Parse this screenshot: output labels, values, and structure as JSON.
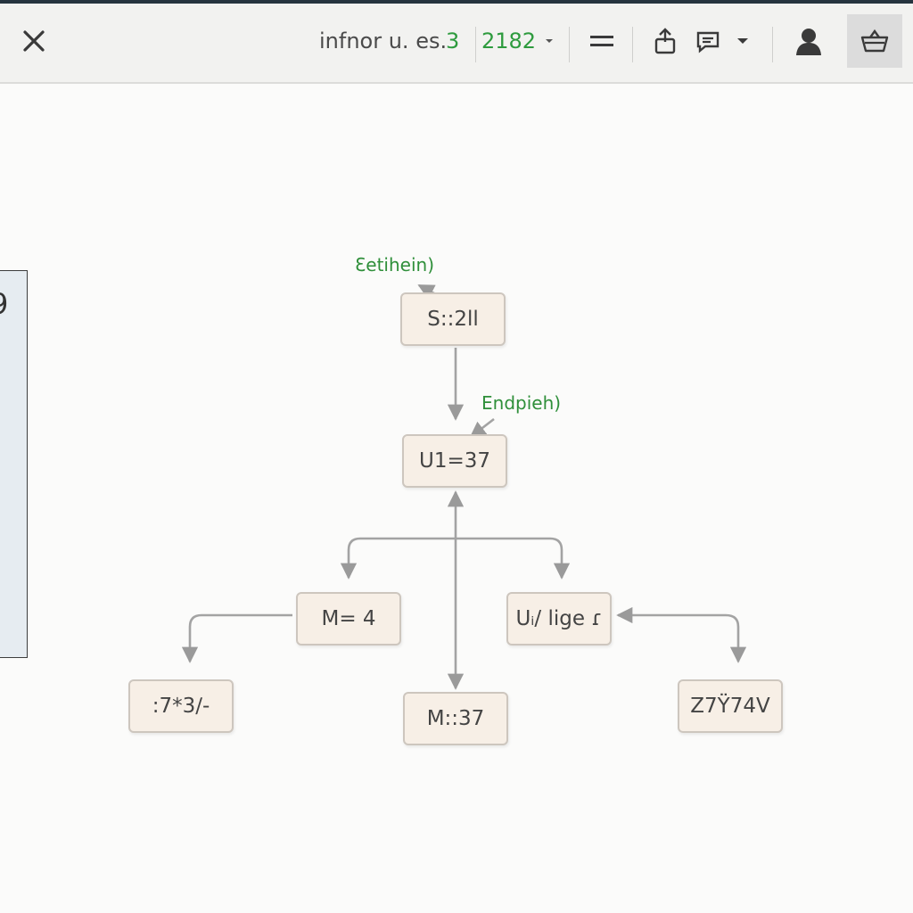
{
  "toolbar": {
    "close_icon": "close-icon",
    "title": "infnor u. es.",
    "status_digit": "3",
    "count": "2182",
    "menu_icon": "menu-icon",
    "share_icon": "share-icon",
    "comment_icon": "comment-icon",
    "user_icon": "user-icon",
    "basket_icon": "basket-icon",
    "accent_color": "#2e9b3e"
  },
  "side_panel": {
    "value": "9"
  },
  "diagram": {
    "nodes": [
      {
        "id": "top",
        "label": "S::2ll"
      },
      {
        "id": "mid",
        "label": "U1=37"
      },
      {
        "id": "left",
        "label": "M= 4"
      },
      {
        "id": "right",
        "label": "Uᵢ/ lige ɾ"
      },
      {
        "id": "bottom",
        "label": "M::37"
      },
      {
        "id": "far-left",
        "label": ":7*3∕-"
      },
      {
        "id": "far-right",
        "label": "Z7Ÿ74V"
      }
    ],
    "edge_labels": [
      "Ɛetihein)",
      "Endpieh)"
    ]
  }
}
